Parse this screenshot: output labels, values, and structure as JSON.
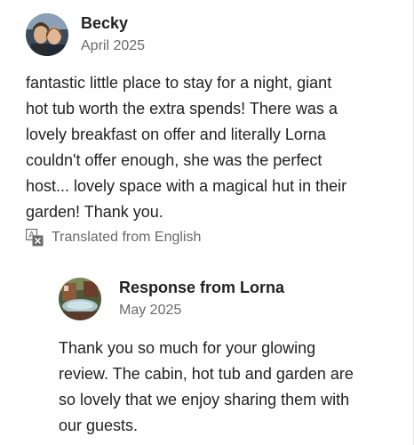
{
  "review": {
    "reviewer": {
      "name": "Becky",
      "date": "April 2025",
      "avatar": "reviewer-photo-avatar"
    },
    "text_lines": [
      "fantastic little place to stay for a night, giant",
      "hot tub worth the extra spends! There was a",
      "lovely breakfast on offer and literally Lorna",
      "couldn't offer enough, she was the perfect",
      "host... lovely space with a magical hut in their",
      "garden! Thank you."
    ],
    "translation": {
      "icon": "translate-icon",
      "label": "Translated from English"
    }
  },
  "response": {
    "host": {
      "name": "Response from Lorna",
      "date": "May 2025",
      "avatar": "host-photo-avatar"
    },
    "text_lines": [
      "Thank you so much for your glowing",
      "review. The cabin, hot tub and garden are",
      "so lovely that we enjoy sharing them with",
      "our guests."
    ]
  },
  "colors": {
    "primary_text": "#222222",
    "secondary_text": "#6a6a6a"
  }
}
